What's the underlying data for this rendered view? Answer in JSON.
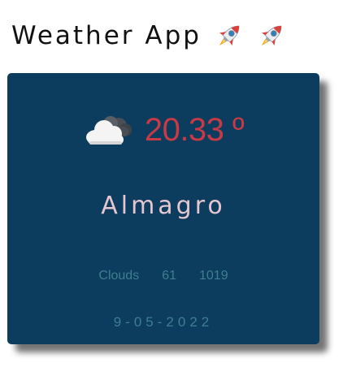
{
  "header": {
    "title": "Weather App",
    "decorations": [
      "rocket-icon",
      "rocket-icon"
    ]
  },
  "weather": {
    "icon": "cloud-icon",
    "temperature": "20.33 º",
    "city": "Almagro",
    "condition": "Clouds",
    "humidity": "61",
    "pressure": "1019",
    "date": "9-05-2022"
  },
  "colors": {
    "card_background": "#0c3c5e",
    "temperature": "#c83a46",
    "city": "#e6c6d0",
    "details": "#3e7f91"
  }
}
